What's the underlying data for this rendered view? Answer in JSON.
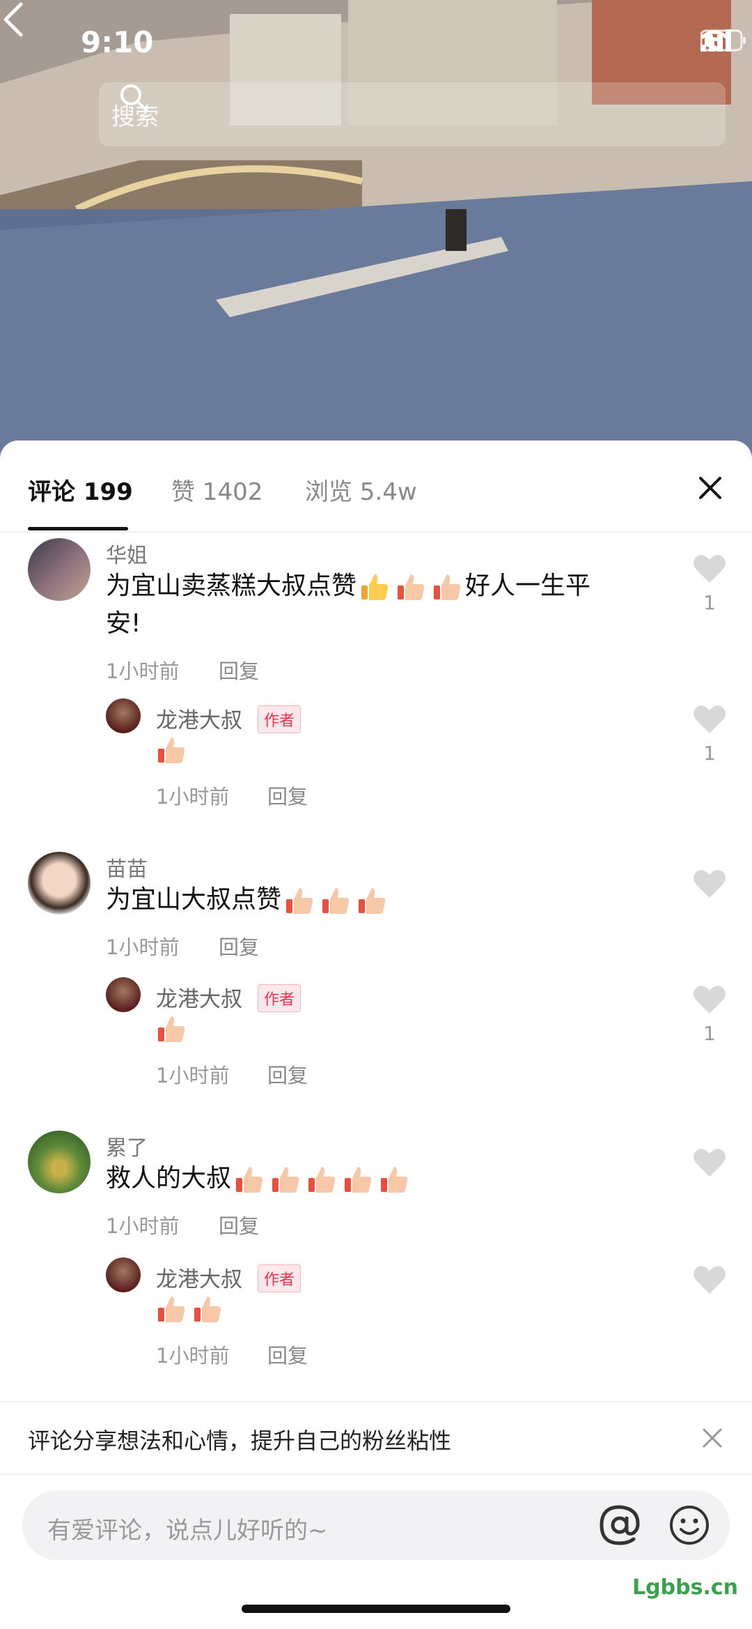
{
  "status": {
    "time": "9:10"
  },
  "search": {
    "placeholder": "搜索"
  },
  "tabs": [
    {
      "label": "评论 199"
    },
    {
      "label": "赞 1402"
    },
    {
      "label": "浏览 5.4w"
    }
  ],
  "comments": [
    {
      "name": "华姐",
      "text_a": "为宜山卖蒸糕大叔点赞",
      "text_b": "好人一生平",
      "text_c": "安!",
      "time": "1小时前",
      "reply": "回复",
      "likes": "1"
    },
    {
      "name": "龙港大叔",
      "badge": "作者",
      "time": "1小时前",
      "reply": "回复",
      "likes": "1"
    },
    {
      "name": "苗苗",
      "text_a": "为宜山大叔点赞",
      "time": "1小时前",
      "reply": "回复"
    },
    {
      "name": "龙港大叔",
      "badge": "作者",
      "time": "1小时前",
      "reply": "回复",
      "likes": "1"
    },
    {
      "name": "累了",
      "text_a": "救人的大叔",
      "time": "1小时前",
      "reply": "回复"
    },
    {
      "name": "龙港大叔",
      "badge": "作者",
      "time": "1小时前",
      "reply": "回复"
    }
  ],
  "tip": {
    "text": "评论分享想法和心情，提升自己的粉丝粘性"
  },
  "input": {
    "placeholder": "有爱评论，说点儿好听的~"
  },
  "watermark": "Lgbbs.cn"
}
